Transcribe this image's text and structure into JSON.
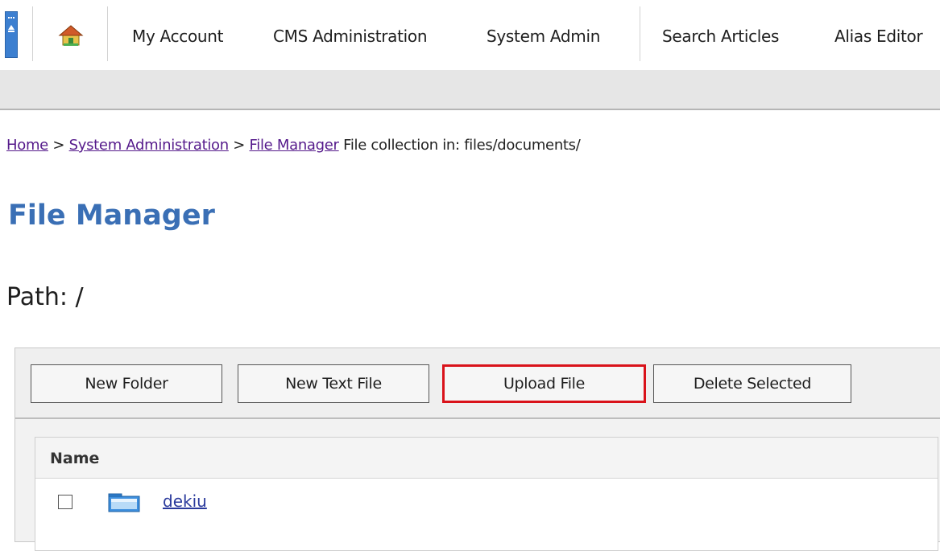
{
  "nav": {
    "items": [
      {
        "label": "My Account"
      },
      {
        "label": "CMS Administration"
      },
      {
        "label": "System Admin"
      },
      {
        "label": "Search Articles"
      },
      {
        "label": "Alias Editor"
      }
    ]
  },
  "breadcrumb": {
    "home": "Home",
    "sep1": " > ",
    "system_admin": "System Administration",
    "sep2": " > ",
    "file_manager": "File Manager",
    "suffix": " File collection in: files/documents/"
  },
  "page": {
    "title": "File Manager",
    "path": "Path: /"
  },
  "toolbar": {
    "new_folder": "New Folder",
    "new_text_file": "New Text File",
    "upload_file": "Upload File",
    "delete_selected": "Delete Selected"
  },
  "list": {
    "header_name": "Name",
    "rows": [
      {
        "name": "dekiu"
      }
    ]
  },
  "colors": {
    "title": "#3a6fb5",
    "highlight": "#d9121a",
    "link_visited": "#551a8b"
  }
}
